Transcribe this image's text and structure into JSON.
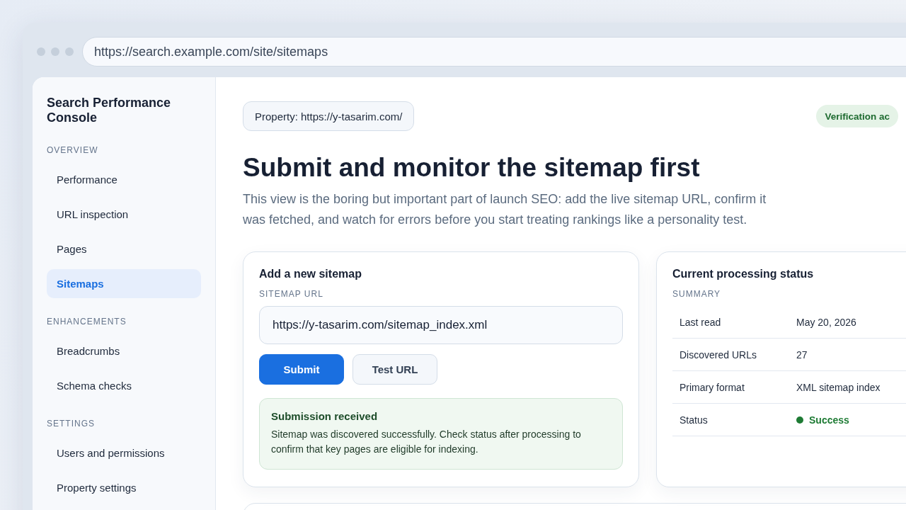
{
  "browser": {
    "url": "https://search.example.com/site/sitemaps"
  },
  "sidebar": {
    "title": "Search Performance Console",
    "sections": [
      {
        "label": "OVERVIEW",
        "items": [
          {
            "label": "Performance",
            "selected": false
          },
          {
            "label": "URL inspection",
            "selected": false
          },
          {
            "label": "Pages",
            "selected": false
          },
          {
            "label": "Sitemaps",
            "selected": true
          }
        ]
      },
      {
        "label": "ENHANCEMENTS",
        "items": [
          {
            "label": "Breadcrumbs",
            "selected": false
          },
          {
            "label": "Schema checks",
            "selected": false
          }
        ]
      },
      {
        "label": "SETTINGS",
        "items": [
          {
            "label": "Users and permissions",
            "selected": false
          },
          {
            "label": "Property settings",
            "selected": false
          }
        ]
      }
    ]
  },
  "main": {
    "property": "Property: https://y-tasarim.com/",
    "badge": "Verification ac",
    "heading": "Submit and monitor the sitemap first",
    "description": "This view is the boring but important part of launch SEO: add the live sitemap URL, confirm it was fetched, and watch for errors before you start treating rankings like a personality test.",
    "submit_card": {
      "title": "Add a new sitemap",
      "field_label": "SITEMAP URL",
      "value": "https://y-tasarim.com/sitemap_index.xml",
      "buttons": [
        {
          "label": "Submit",
          "kind": "primary"
        },
        {
          "label": "Test URL",
          "kind": "secondary"
        }
      ],
      "alert": {
        "title": "Submission received",
        "text": "Sitemap was discovered successfully. Check status after processing to confirm that key pages are eligible for indexing."
      }
    },
    "status_card": {
      "title": "Current processing status",
      "section_label": "SUMMARY",
      "rows": [
        {
          "label": "Last read",
          "value": "May 20, 2026",
          "kind": "text"
        },
        {
          "label": "Discovered URLs",
          "value": "27",
          "kind": "text"
        },
        {
          "label": "Primary format",
          "value": "XML sitemap index",
          "kind": "text"
        },
        {
          "label": "Status",
          "value": "Success",
          "kind": "status",
          "color": "#1e7b34"
        }
      ]
    }
  }
}
